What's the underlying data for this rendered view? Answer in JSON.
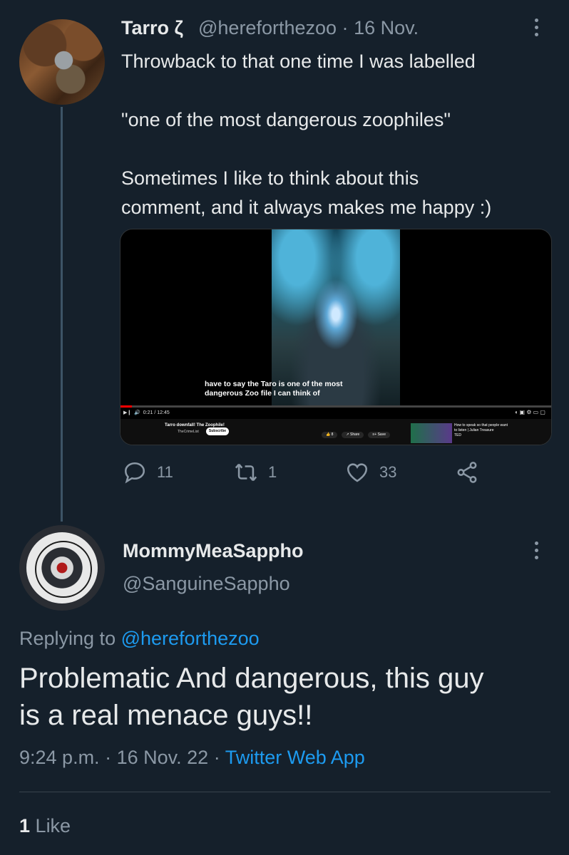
{
  "tweet1": {
    "author_name": "Tarro ζ",
    "author_handle": "@hereforthezoo",
    "separator": "·",
    "date": "16 Nov.",
    "text_lines": [
      "Throwback to that one time I was labelled",
      "\"one of the most dangerous zoophiles\"",
      "Sometimes I like to think about this",
      "comment, and it always makes me happy :)"
    ],
    "media": {
      "subtitle_line1": "have to say the Taro is one of the most",
      "subtitle_line2": "dangerous Zoo file I can think of",
      "timestamp": "0:21 / 12:45",
      "video_title": "Tarro downfall! The Zoophile!",
      "channel_name": "TheCrimeList",
      "subscribe_label": "Subscribe",
      "like_label": "8",
      "share_label": "Share",
      "save_label": "Save",
      "next_title": "How to speak so that people want to listen | Julian Treasure",
      "next_channel": "TED",
      "progress_fraction": 0.027
    },
    "replies_count": "11",
    "retweets_count": "1",
    "likes_count": "33"
  },
  "tweet2": {
    "author_name": "MommyMeaSappho",
    "author_handle": "@SanguineSappho",
    "replying_prefix": "Replying to",
    "replying_handle": "@hereforthezoo",
    "text_line1": "Problematic And dangerous, this guy",
    "text_line2": "is a real menace guys!!",
    "time": "9:24 p.m.",
    "separator": "·",
    "date": "16 Nov. 22",
    "app": "Twitter Web App",
    "likes_count": "1",
    "likes_label": "Like"
  },
  "colors": {
    "background": "#15202b",
    "text": "#e7e9ea",
    "muted": "#8b98a5",
    "accent": "#1d9bf0"
  }
}
